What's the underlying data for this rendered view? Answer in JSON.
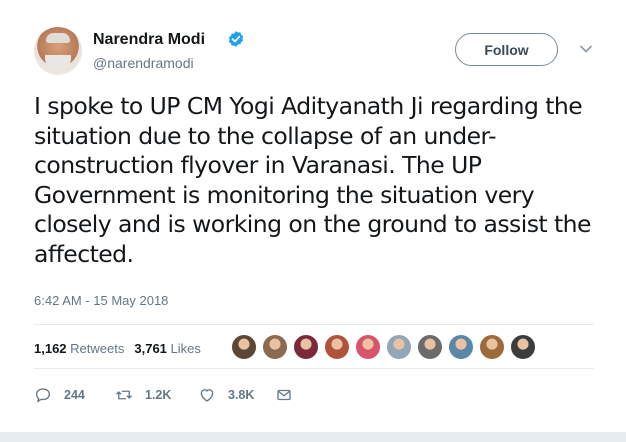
{
  "author": {
    "name": "Narendra Modi",
    "handle": "@narendramodi"
  },
  "follow_label": "Follow",
  "tweet": {
    "text": "I spoke to UP CM Yogi Adityanath Ji regarding the situation due to the collapse of an under-construction flyover in Varanasi. The UP Government is monitoring the situation very closely and is working on the ground to assist the affected.",
    "timestamp": "6:42 AM - 15 May 2018"
  },
  "stats": {
    "retweets_count": "1,162",
    "retweets_label": "Retweets",
    "likes_count": "3,761",
    "likes_label": "Likes"
  },
  "likers": [
    {
      "color": "#5b4638"
    },
    {
      "color": "#8c6a4f"
    },
    {
      "color": "#7a2a3a"
    },
    {
      "color": "#b0523c"
    },
    {
      "color": "#d9546b"
    },
    {
      "color": "#8fa7b8"
    },
    {
      "color": "#6b6b6b"
    },
    {
      "color": "#5a86a8"
    },
    {
      "color": "#9b6b3a"
    },
    {
      "color": "#3d3d3d"
    }
  ],
  "actions": {
    "reply_count": "244",
    "retweet_count": "1.2K",
    "like_count": "3.8K"
  },
  "icons": {
    "verified": "verified-badge-icon",
    "chevron": "chevron-down-icon",
    "reply": "reply-icon",
    "retweet": "retweet-icon",
    "like": "heart-icon",
    "message": "direct-message-icon"
  },
  "colors": {
    "verified_blue": "#1da1f2",
    "muted_text": "#657786",
    "divider": "#e6ecf0"
  }
}
